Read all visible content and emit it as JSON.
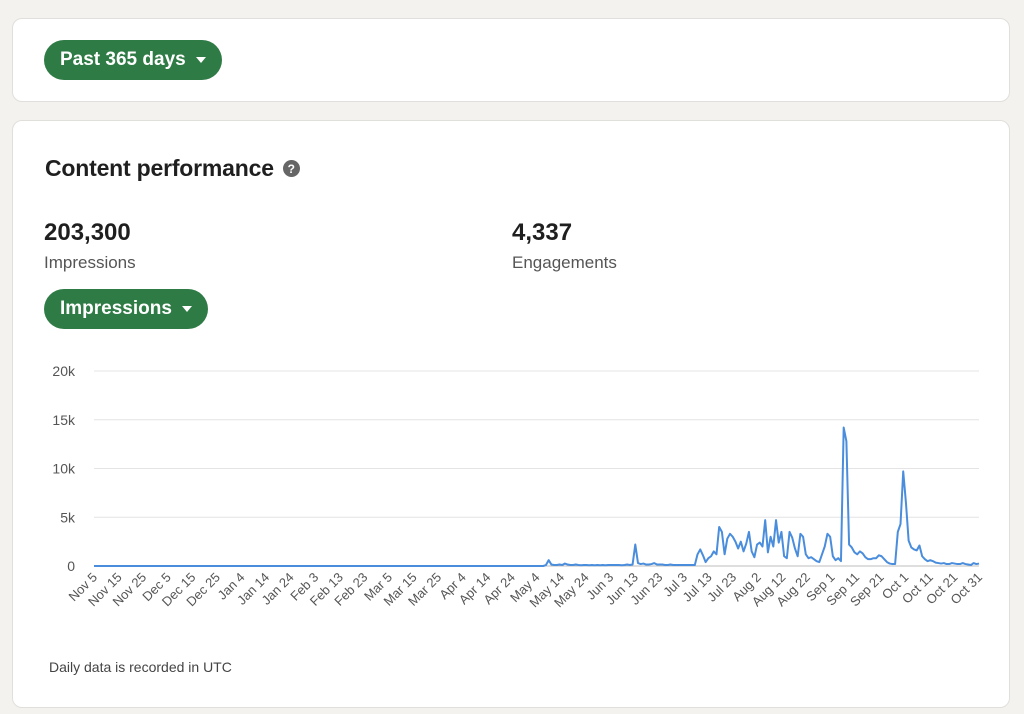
{
  "filter": {
    "range_label": "Past 365 days"
  },
  "section": {
    "title": "Content performance",
    "help_icon": "question-circle-icon"
  },
  "stats": [
    {
      "value": "203,300",
      "label": "Impressions"
    },
    {
      "value": "4,337",
      "label": "Engagements"
    }
  ],
  "metric_selector": {
    "label": "Impressions"
  },
  "footnote": "Daily data is recorded in UTC",
  "colors": {
    "accent": "#2f7b45",
    "line": "#4a8ddc",
    "grid": "#e4e4e4"
  },
  "chart_data": {
    "type": "line",
    "x_tick_labels": [
      "Nov 5",
      "Nov 15",
      "Nov 25",
      "Dec 5",
      "Dec 15",
      "Dec 25",
      "Jan 4",
      "Jan 14",
      "Jan 24",
      "Feb 3",
      "Feb 13",
      "Feb 23",
      "Mar 5",
      "Mar 15",
      "Mar 25",
      "Apr 4",
      "Apr 14",
      "Apr 24",
      "May 4",
      "May 14",
      "May 24",
      "Jun 3",
      "Jun 13",
      "Jun 23",
      "Jul 3",
      "Jul 13",
      "Jul 23",
      "Aug 2",
      "Aug 12",
      "Aug 22",
      "Sep 1",
      "Sep 11",
      "Sep 21",
      "Oct 1",
      "Oct 11",
      "Oct 21",
      "Oct 31"
    ],
    "y_ticks": [
      0,
      5000,
      10000,
      15000,
      20000
    ],
    "y_tick_labels": [
      "0",
      "5k",
      "10k",
      "15k",
      "20k"
    ],
    "ylim": [
      0,
      20000
    ],
    "grid": true,
    "series": [
      {
        "x_start": "Nov 5",
        "values": [
          0,
          0,
          0,
          0,
          0,
          0,
          0,
          0,
          0,
          0,
          0,
          0,
          0,
          0,
          0,
          0,
          0,
          0,
          0,
          0,
          0,
          0,
          0,
          0,
          0,
          0,
          0,
          0,
          0,
          0,
          0,
          0,
          0,
          0,
          0,
          0,
          0,
          0,
          0,
          0,
          0,
          0,
          0,
          0,
          0,
          0,
          0,
          0,
          0,
          0,
          0,
          0,
          0,
          0,
          0,
          0,
          0,
          0,
          0,
          0,
          0,
          0,
          0,
          0,
          0,
          0,
          0,
          0,
          0,
          0,
          0,
          0,
          0,
          0,
          0,
          0,
          0,
          0,
          0,
          0,
          0,
          0,
          0,
          0,
          0,
          0,
          0,
          0,
          0,
          0,
          0,
          0,
          0,
          0,
          0,
          0,
          0,
          0,
          0,
          0,
          0,
          0,
          0,
          0,
          0,
          0,
          0,
          0,
          0,
          0,
          0,
          0,
          0,
          0,
          0,
          0,
          0,
          0,
          0,
          0,
          0,
          0,
          0,
          0,
          0,
          0,
          0,
          0,
          0,
          0,
          0,
          0,
          0,
          0,
          0,
          0,
          0,
          0,
          0,
          0,
          0,
          0,
          0,
          0,
          0,
          0,
          0,
          0,
          0,
          0,
          0,
          0,
          0,
          0,
          0,
          0,
          0,
          0,
          0,
          0,
          0,
          0,
          0,
          0,
          0,
          0,
          0,
          100,
          600,
          150,
          100,
          100,
          150,
          100,
          250,
          150,
          100,
          100,
          150,
          100,
          80,
          100,
          100,
          80,
          100,
          80,
          100,
          80,
          100,
          80,
          100,
          100,
          100,
          100,
          100,
          80,
          100,
          150,
          100,
          150,
          2200,
          300,
          200,
          250,
          150,
          150,
          200,
          300,
          150,
          150,
          150,
          100,
          100,
          150,
          100,
          100,
          100,
          100,
          100,
          100,
          100,
          100,
          100,
          1200,
          1700,
          1100,
          400,
          800,
          1000,
          1500,
          1200,
          4000,
          3500,
          1200,
          2800,
          3300,
          3000,
          2500,
          1800,
          2500,
          1500,
          2300,
          3500,
          1500,
          900,
          2200,
          2400,
          2000,
          4700,
          1400,
          3000,
          2000,
          4700,
          2400,
          3500,
          1000,
          800,
          3500,
          2900,
          1800,
          1000,
          3300,
          3000,
          1200,
          800,
          900,
          700,
          500,
          400,
          1200,
          2000,
          3300,
          3000,
          1000,
          600,
          800,
          500,
          14200,
          12800,
          2200,
          1900,
          1400,
          1200,
          1500,
          1300,
          900,
          700,
          700,
          800,
          800,
          1100,
          1000,
          700,
          400,
          250,
          200,
          200,
          3500,
          4300,
          9700,
          6500,
          2600,
          1900,
          1700,
          1600,
          2100,
          1000,
          700,
          500,
          600,
          500,
          350,
          300,
          250,
          300,
          200,
          200,
          300,
          250,
          200,
          200,
          300,
          200,
          150,
          100,
          300,
          200,
          250
        ]
      }
    ]
  }
}
